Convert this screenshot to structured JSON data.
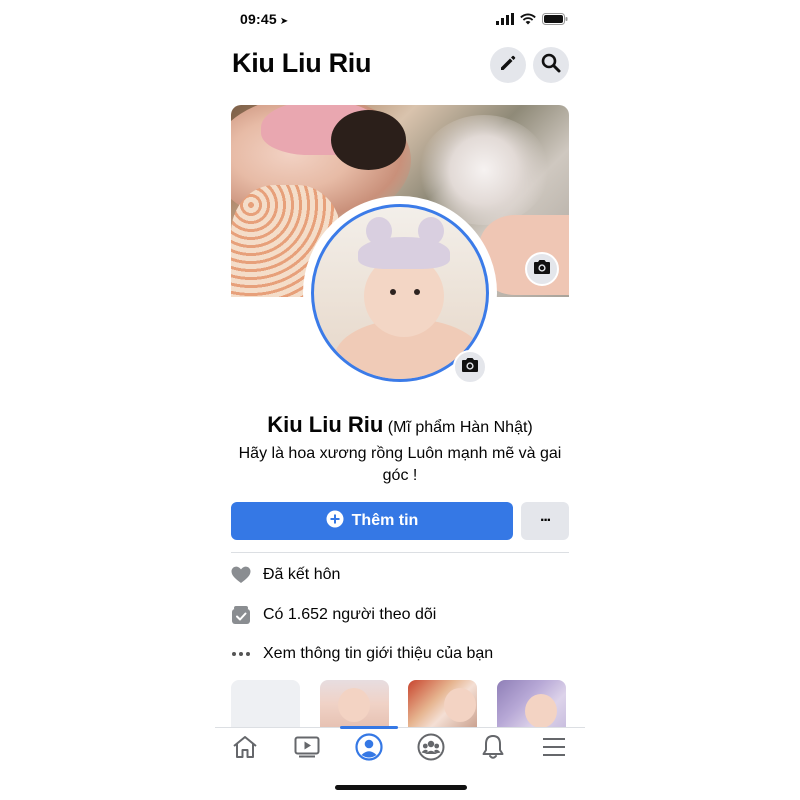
{
  "status_bar": {
    "time": "09:45"
  },
  "header": {
    "title": "Kiu Liu Riu"
  },
  "profile": {
    "name": "Kiu Liu Riu",
    "alternate_name": "(Mĩ phẩm Hàn Nhật)",
    "bio": "Hãy là hoa xương rồng Luôn mạnh mẽ và gai góc !"
  },
  "actions": {
    "add_story_label": "Thêm tin",
    "more_label": "···"
  },
  "info": [
    {
      "icon": "heart-icon",
      "text": "Đã kết hôn"
    },
    {
      "icon": "followers-icon",
      "text": "Có 1.652 người theo dõi"
    },
    {
      "icon": "more-dots-icon",
      "text": "Xem thông tin giới thiệu của bạn"
    }
  ],
  "bottom_nav": [
    "home-icon",
    "watch-icon",
    "profile-icon",
    "groups-icon",
    "notifications-icon",
    "menu-icon"
  ],
  "colors": {
    "accent": "#3578e5",
    "button_grey": "#e4e6eb",
    "text": "#050505"
  }
}
